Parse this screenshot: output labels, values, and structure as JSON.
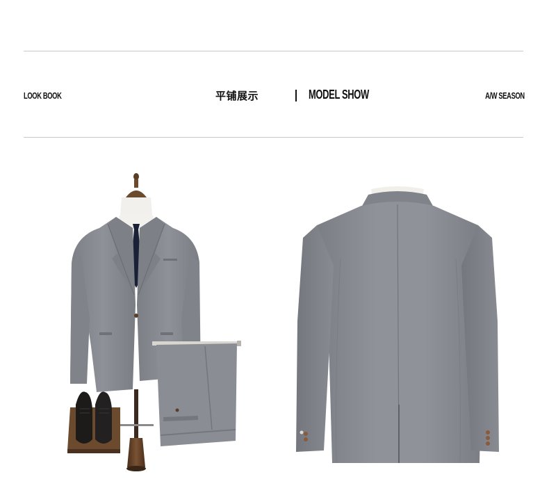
{
  "header": {
    "left_label": "LOOK BOOK",
    "title_cn": "平铺展示",
    "title_en": "MODEL SHOW",
    "right_label": "A/W SEASON"
  },
  "colors": {
    "suit": "#8a8e94",
    "suit_shadow": "#74787e",
    "suit_highlight": "#9da1a6",
    "tie": "#1a2035",
    "shirt": "#f3f1ed",
    "rule": "#c9c9c9",
    "wood": "#6b4a2e",
    "shoe": "#1d1b1a"
  },
  "images": [
    {
      "name": "front-view-suit-on-mannequin",
      "icon": "mannequin-suit-icon"
    },
    {
      "name": "back-view-suit-jacket",
      "icon": "jacket-back-icon"
    }
  ]
}
